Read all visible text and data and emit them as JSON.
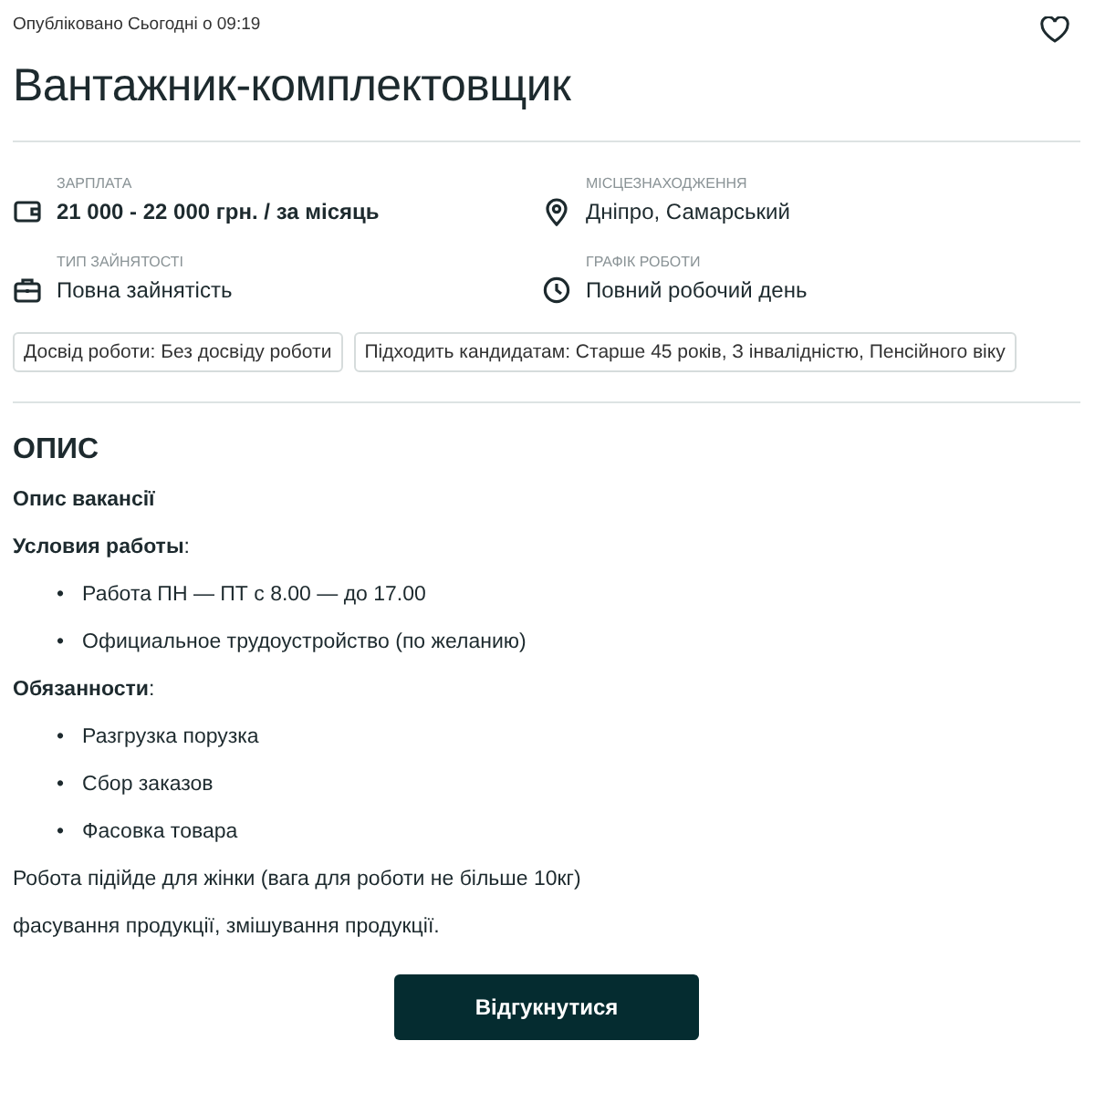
{
  "published": "Опубліковано Сьогодні о 09:19",
  "title": "Вантажник-комплектовщик",
  "facts": [
    {
      "kind": "wallet",
      "label": "ЗАРПЛАТА",
      "value": "21 000 - 22 000 грн. / за місяць",
      "bold": true
    },
    {
      "kind": "pin",
      "label": "МІСЦЕЗНАХОДЖЕННЯ",
      "value": "Дніпро, Самарський",
      "bold": false
    },
    {
      "kind": "briefcase",
      "label": "ТИП ЗАЙНЯТОСТІ",
      "value": "Повна зайнятість",
      "bold": false
    },
    {
      "kind": "clock",
      "label": "ГРАФІК РОБОТИ",
      "value": "Повний робочий день",
      "bold": false
    }
  ],
  "tags": [
    "Досвід роботи: Без досвіду роботи",
    "Підходить кандидатам: Старше 45 років, З інвалідністю, Пенсійного віку"
  ],
  "description": {
    "heading": "ОПИС",
    "blocks": [
      {
        "kind": "heading",
        "text": "**Опис вакансії**"
      },
      {
        "kind": "heading",
        "text": "**Условия работы**:"
      },
      {
        "kind": "list",
        "marker": "•",
        "items": [
          "Работа ПН — ПТ с 8.00 — до 17.00",
          "Официальное трудоустройство (по желанию)"
        ]
      },
      {
        "kind": "heading",
        "text": "**Обязанности**:"
      },
      {
        "kind": "list",
        "marker": "•",
        "items": [
          "Разгрузка порузка",
          "Сбор заказов",
          "Фасовка товара"
        ]
      },
      {
        "kind": "paragraph",
        "text": "Робота підійде для жінки (вага для роботи не більше 10кг)"
      },
      {
        "kind": "paragraph",
        "text": "фасування продукції, змішування продукції."
      }
    ]
  },
  "apply_button": "Відгукнутися"
}
